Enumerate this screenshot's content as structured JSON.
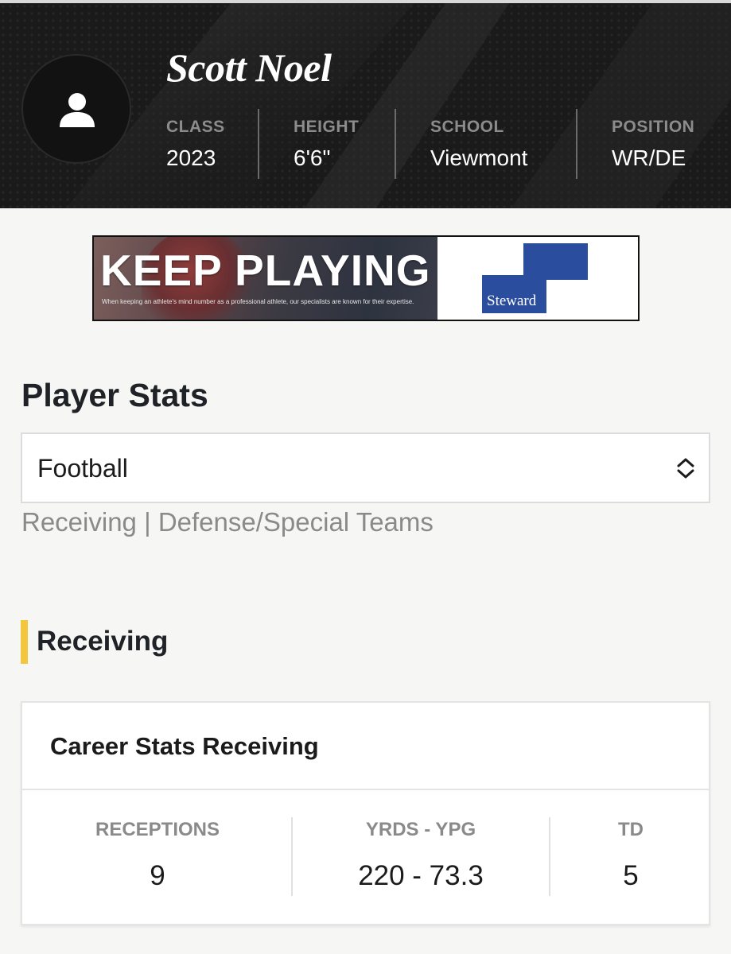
{
  "player": {
    "name": "Scott Noel",
    "stats": [
      {
        "label": "CLASS",
        "value": "2023"
      },
      {
        "label": "HEIGHT",
        "value": "6'6\""
      },
      {
        "label": "SCHOOL",
        "value": "Viewmont"
      },
      {
        "label": "POSITION",
        "value": "WR/DE"
      }
    ]
  },
  "ad": {
    "headline": "KEEP PLAYING",
    "subtext": "When keeping an athlete's mind number as a professional athlete, our specialists are known for their expertise.",
    "brand": "Steward",
    "brand_color": "#2a4d9e"
  },
  "player_stats": {
    "title": "Player Stats",
    "sport_select": {
      "value": "Football"
    },
    "subnav": "Receiving | Defense/Special Teams"
  },
  "receiving": {
    "title": "Receiving",
    "accent_color": "#f4c63d",
    "card": {
      "title": "Career Stats Receiving",
      "stats": [
        {
          "label": "RECEPTIONS",
          "value": "9"
        },
        {
          "label": "YRDS - YPG",
          "value": "220 - 73.3"
        },
        {
          "label": "TD",
          "value": "5"
        }
      ]
    }
  }
}
